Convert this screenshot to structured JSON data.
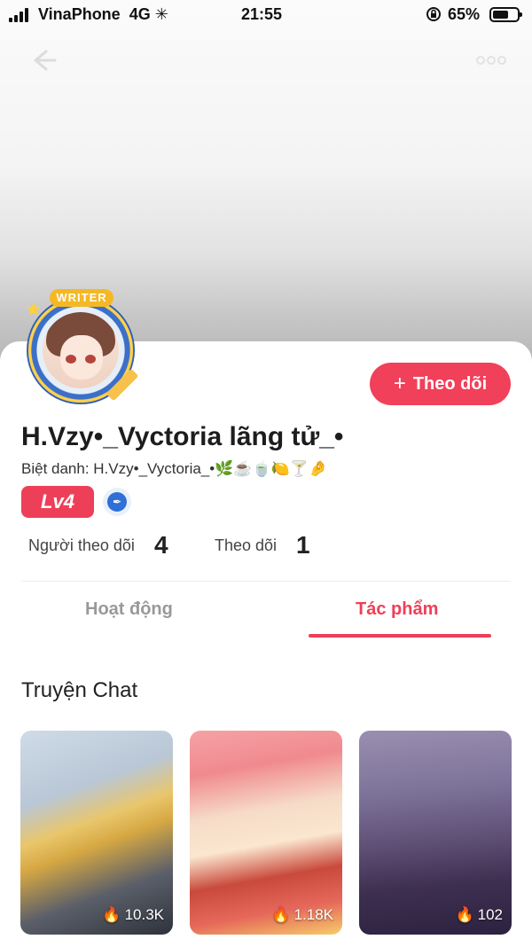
{
  "status_bar": {
    "carrier": "VinaPhone",
    "network": "4G",
    "time": "21:55",
    "battery_percent": "65%",
    "battery_level": 0.65
  },
  "header": {
    "back_icon": "back-arrow-icon",
    "more_icon": "more-dots-icon"
  },
  "profile": {
    "avatar_badge": "WRITER",
    "name": "H.Vzy•_Vyctoria lãng tử_•",
    "nickname": "Biệt danh: H.Vzy•_Vyctoria_•🌿☕🍵🍋🍸🤌",
    "level": "Lv4",
    "follow_button": "Theo dõi",
    "stats": {
      "followers_label": "Người theo dõi",
      "followers_value": "4",
      "following_label": "Theo dõi",
      "following_value": "1"
    }
  },
  "tabs": [
    {
      "label": "Hoạt động",
      "active": false
    },
    {
      "label": "Tác phẩm",
      "active": true
    }
  ],
  "section": {
    "title": "Truyện Chat",
    "items": [
      {
        "views": "10.3K"
      },
      {
        "views": "1.18K"
      },
      {
        "views": "102"
      }
    ]
  },
  "colors": {
    "accent": "#ee3f58",
    "follow_button": "#f1405a",
    "verify_badge": "#2f6fd6"
  }
}
